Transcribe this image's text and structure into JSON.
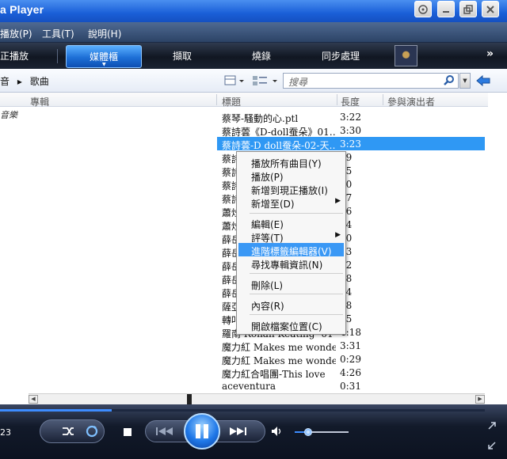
{
  "window": {
    "title": "a Player"
  },
  "menu": [
    "播放(P)",
    "工具(T)",
    "說明(H)"
  ],
  "tasks": {
    "now_playing": "正播放",
    "library": "媒體櫃",
    "rip": "擷取",
    "burn": "燒錄",
    "sync": "同步處理",
    "more": "»"
  },
  "breadcrumb": [
    "音",
    "歌曲"
  ],
  "search": {
    "placeholder": "搜尋"
  },
  "columns": {
    "album": "專輯",
    "title": "標題",
    "length": "長度",
    "artist": "參與演出者"
  },
  "left_label": "音樂",
  "rows": [
    {
      "title": "蔡琴-騷動的心.ptl",
      "length": "3:22"
    },
    {
      "title": "蔡詩蕓《D-doll蚕朵》01…",
      "length": "3:30"
    },
    {
      "title": "蔡詩蕓-D doll蚕朵-02-天…",
      "length": "3:23",
      "selected": true
    },
    {
      "title": "蔡詩",
      "length": "19"
    },
    {
      "title": "蔡詩",
      "length": "15"
    },
    {
      "title": "蔡詩",
      "length": "40"
    },
    {
      "title": "蔡詩",
      "length": "27"
    },
    {
      "title": "蕭炒",
      "length": "16"
    },
    {
      "title": "蕭炒",
      "length": "44"
    },
    {
      "title": "薛岳",
      "length": "50"
    },
    {
      "title": "薛岳",
      "length": "43"
    },
    {
      "title": "薛岳",
      "length": "32"
    },
    {
      "title": "薛岳",
      "length": "08"
    },
    {
      "title": "薛岳",
      "length": "04"
    },
    {
      "title": "薩亞",
      "length": "58"
    },
    {
      "title": "轉叩",
      "length": "45"
    },
    {
      "title": "羅南 Ronan Keating -01-W…",
      "length": "4:18"
    },
    {
      "title": "魔力紅 Makes me wonder…",
      "length": "3:31"
    },
    {
      "title": "魔力紅 Makes me wonder鈴",
      "length": "0:29"
    },
    {
      "title": "魔力紅合唱團-This love",
      "length": "4:26"
    },
    {
      "title": "aceventura",
      "length": "0:31"
    }
  ],
  "context_menu": {
    "play_all": "播放所有曲目(Y)",
    "play": "播放(P)",
    "add_now_playing": "新增到現正播放(I)",
    "add_to": "新增至(D)",
    "edit": "編輯(E)",
    "rate": "評等(T)",
    "advanced_tag_editor": "進階標籤編輯器(V)",
    "find_album_info": "尋找專輯資訊(N)",
    "delete": "刪除(L)",
    "properties": "內容(R)",
    "open_file_location": "開啟檔案位置(C)"
  },
  "player": {
    "time": "23",
    "seek_progress": 0.23,
    "volume": 0.25
  }
}
